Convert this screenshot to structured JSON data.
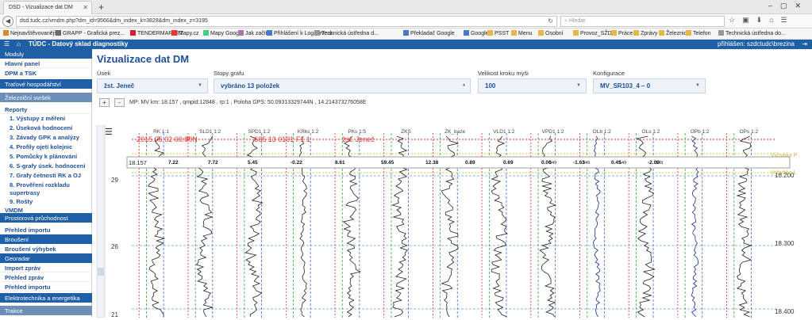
{
  "browser": {
    "tab_title": "DSD - Vizualizace dat DM",
    "url": "dsd.tudc.cz/vmdm.php?dm_id=9566&dm_index_k=3828&dm_index_z=3195",
    "search_placeholder": "Hledat",
    "bookmarks": [
      "Nejnavštěvovanější",
      "GRAPP - Grafická prez...",
      "TENDERMARKET",
      "Mapy.cz",
      "Mapy Google",
      "Jak začít",
      "Přihlášení k Logserveru",
      "Technická ústředna d...",
      "Překladač Google",
      "Google",
      "PSST",
      "Menu",
      "Osobní",
      "Provoz_SŽDC",
      "Práce",
      "Zprávy",
      "Železnice",
      "Telefon",
      "Technická ústředna do..."
    ]
  },
  "app": {
    "title": "TÚDC - Datový sklad diagnostiky",
    "logged_in": "přihlášen: szdctudc\\brezina"
  },
  "sidebar": [
    {
      "label": "Moduly",
      "kind": "section"
    },
    {
      "label": "Hlavní panel",
      "kind": "link"
    },
    {
      "label": "DPM a TSK",
      "kind": "link"
    },
    {
      "label": "Traťové hospodářství",
      "kind": "section"
    },
    {
      "label": "Železniční svršek",
      "kind": "grey"
    },
    {
      "label": "Reporty",
      "kind": "link"
    },
    {
      "label": "1. Výstupy z měření",
      "kind": "sub"
    },
    {
      "label": "2. Úseková hodnocení",
      "kind": "sub"
    },
    {
      "label": "3. Závady GPK a analýzy",
      "kind": "sub"
    },
    {
      "label": "4. Profily ojetí kolejnic",
      "kind": "sub"
    },
    {
      "label": "5. Pomůcky k plánování",
      "kind": "sub"
    },
    {
      "label": "6. S-grafy úsek. hodnocení",
      "kind": "sub"
    },
    {
      "label": "7. Grafy četnosti RK a OJ",
      "kind": "sub"
    },
    {
      "label": "8. Prověření rozkladu",
      "kind": "sub"
    },
    {
      "label": "supertrasy",
      "kind": "sub"
    },
    {
      "label": "9. Rošty",
      "kind": "sub"
    },
    {
      "label": "VMDM",
      "kind": "link"
    },
    {
      "label": "Prostorová průchodnost",
      "kind": "section"
    },
    {
      "label": "Přehled importu",
      "kind": "link"
    },
    {
      "label": "Broušení",
      "kind": "section"
    },
    {
      "label": "Broušení výhybek",
      "kind": "link"
    },
    {
      "label": "Georadar",
      "kind": "section"
    },
    {
      "label": "Import zpráv",
      "kind": "link"
    },
    {
      "label": "Přehled zpráv",
      "kind": "link"
    },
    {
      "label": "Přehled importu",
      "kind": "link"
    },
    {
      "label": "Elektrotechnika a energetika",
      "kind": "section"
    },
    {
      "label": "Trakce",
      "kind": "grey"
    }
  ],
  "main": {
    "title": "Vizualizace dat DM",
    "fields": [
      {
        "label": "Úsek",
        "value": "žst. Jeneč"
      },
      {
        "label": "Stopy grafu",
        "value": "vybráno 13 položek"
      },
      {
        "label": "Velikost kroku myši",
        "value": "100"
      },
      {
        "label": "Konfigurace",
        "value": "MV_SR103_4 – 0"
      }
    ],
    "zoom_in": "+",
    "zoom_out": "-",
    "mp_info": "MP: MV km: 18.157 , qmpid:12848 , rp:1 , Poloha GPS: 50.09313329744N , 14.214373276058E"
  },
  "chart_data": {
    "type": "line",
    "tracks": [
      "RK 1:1",
      "SLD1 1:2",
      "SPD1 1:2",
      "KRks 1:2",
      "PKs 1:5",
      "ZKS",
      "ZK_baze",
      "VLD1 1:2",
      "VPD1 1:2",
      "OLb 1:2",
      "OLs 1:2",
      "OPb 1:2",
      "OPs 1:2"
    ],
    "cursor_values": [
      "7.22",
      "7.72",
      "5.45",
      "-0.22",
      "8.61",
      "59.45",
      "12.38",
      "0.89",
      "0.69",
      "0.00",
      "549",
      "-1.63",
      "549",
      "0.45",
      "549",
      "-2.00",
      "549"
    ],
    "cursor_km": "18.157",
    "header_annotations": [
      "2015.06.02 00:00",
      "P N",
      "665 13 0101 F1 1",
      "žst. Jeneč"
    ],
    "left_axis_ticks": [
      "29",
      "26",
      "21"
    ],
    "right_axis_ticks": [
      "18.200",
      "18.300",
      "18.400"
    ],
    "side_labels": [
      "Výhybka P",
      "Výhybka L"
    ],
    "colors": {
      "red_dotted": "#e33030",
      "blue_dash": "#3a6fd8",
      "green_dash": "#3aa83a",
      "cursor_band": "#ffffff"
    }
  }
}
